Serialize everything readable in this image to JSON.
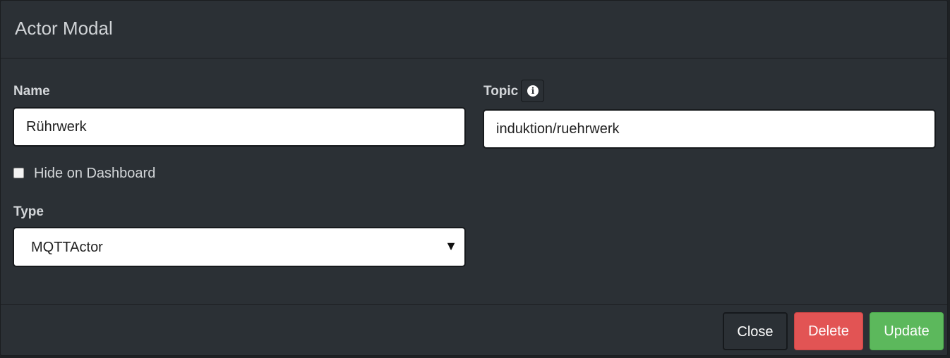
{
  "modal": {
    "title": "Actor Modal"
  },
  "form": {
    "name_label": "Name",
    "name_value": "Rührwerk",
    "topic_label": "Topic",
    "topic_value": "induktion/ruehrwerk",
    "topic_info_icon": "info-circle-icon",
    "hide_checkbox_label": "Hide on Dashboard",
    "hide_checkbox_checked": false,
    "type_label": "Type",
    "type_value": "MQTTActor",
    "type_arrow": "▼"
  },
  "footer": {
    "close_label": "Close",
    "delete_label": "Delete",
    "update_label": "Update"
  },
  "colors": {
    "background": "#2b3035",
    "delete": "#e25454",
    "update": "#5cb85c"
  }
}
